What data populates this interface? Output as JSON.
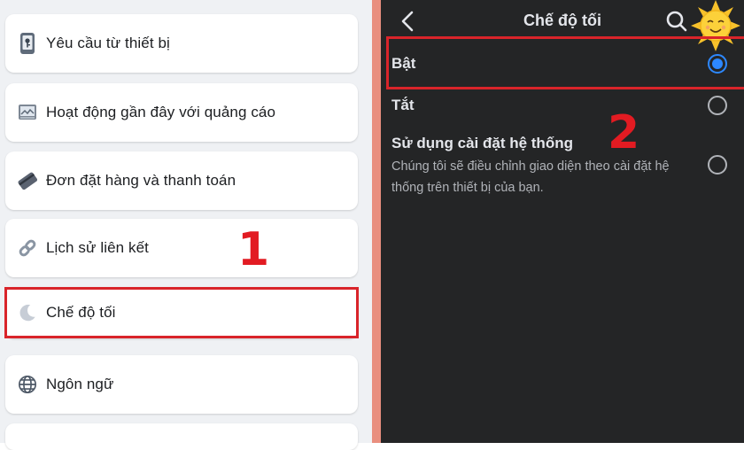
{
  "settings_menu": {
    "items": [
      {
        "label": "Yêu cầu từ thiết bị",
        "icon": "phone-key-icon"
      },
      {
        "label": "Hoạt động gần đây với quảng cáo",
        "icon": "ad-screen-icon"
      },
      {
        "label": "Đơn đặt hàng và thanh toán",
        "icon": "card-icon"
      },
      {
        "label": "Lịch sử liên kết",
        "icon": "link-icon"
      },
      {
        "label": "Chế độ tối",
        "icon": "moon-icon"
      },
      {
        "label": "Ngôn ngữ",
        "icon": "globe-icon"
      }
    ],
    "highlighted_item": "Chế độ tối"
  },
  "step_labels": {
    "first": "1",
    "second": "2"
  },
  "dark_mode_screen": {
    "title": "Chế độ tối",
    "options": [
      {
        "label": "Bật",
        "selected": true
      },
      {
        "label": "Tắt",
        "selected": false
      },
      {
        "label": "Sử dụng cài đặt hệ thống",
        "selected": false,
        "description": "Chúng tôi sẽ điều chỉnh giao diện theo cài đặt hệ thống trên thiết bị của bạn."
      }
    ]
  },
  "colors": {
    "accent_blue": "#2d88ff",
    "highlight_red": "#d9242a",
    "dark_background": "#242526",
    "light_background": "#eff1f4"
  }
}
